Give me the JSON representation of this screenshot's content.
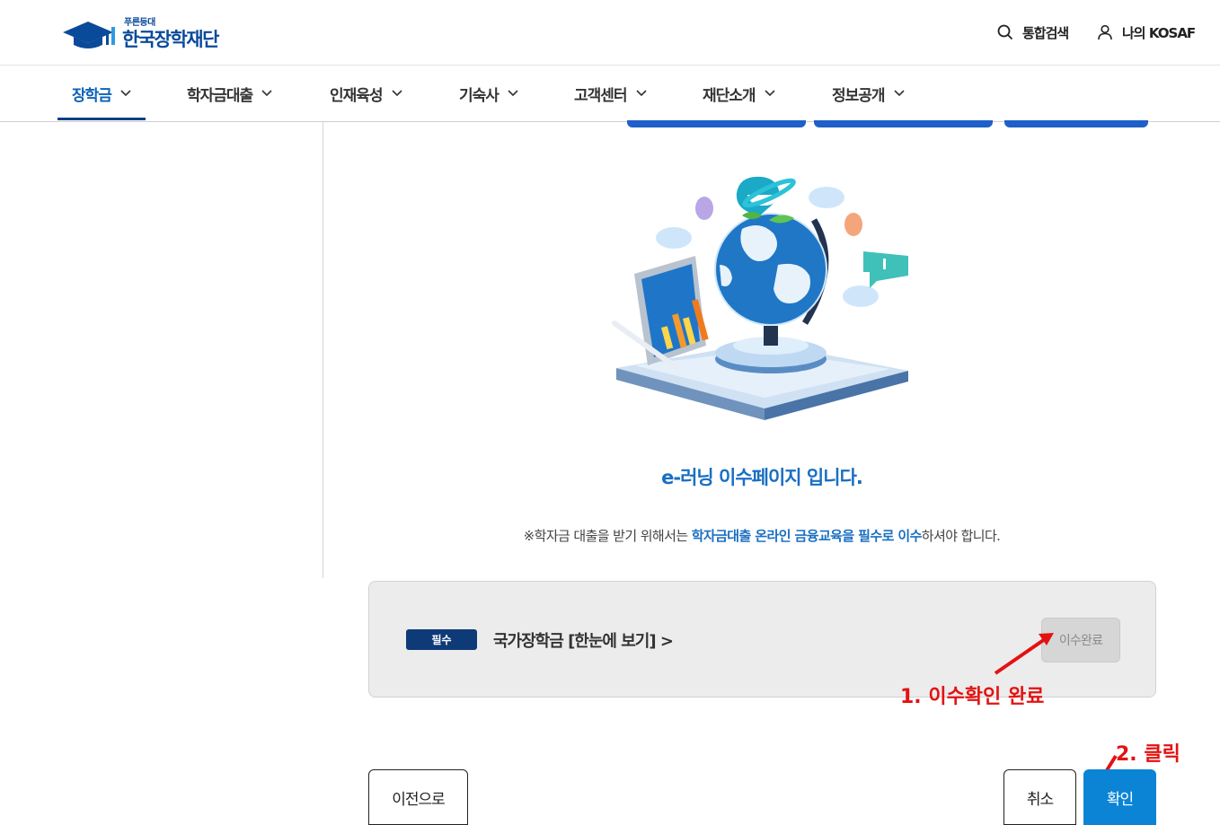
{
  "header": {
    "logo_small": "푸른등대",
    "logo_main": "한국장학재단",
    "search_label": "통합검색",
    "my_label": "나의 KOSAF"
  },
  "gnb": {
    "items": [
      {
        "label": "장학금",
        "active": true
      },
      {
        "label": "학자금대출"
      },
      {
        "label": "인재육성"
      },
      {
        "label": "기숙사"
      },
      {
        "label": "고객센터"
      },
      {
        "label": "재단소개"
      },
      {
        "label": "정보공개"
      }
    ]
  },
  "main": {
    "title": "e-러닝 이수페이지 입니다.",
    "notice_prefix": "※학자금 대출을 받기 위해서는 ",
    "notice_highlight": "학자금대출 온라인 금융교육을 필수로 이수",
    "notice_suffix": "하셔야 합니다."
  },
  "course": {
    "badge": "필수",
    "link_label": "국가장학금 [한눈에 보기] >",
    "status_label": "이수완료"
  },
  "annotations": {
    "step1": "1. 이수확인 완료",
    "step2": "2. 클릭"
  },
  "buttons": {
    "prev": "이전으로",
    "cancel": "취소",
    "ok": "확인"
  },
  "colors": {
    "brand": "#0a4a9a",
    "accent": "#1a6fc2",
    "ok_button": "#0b84d6",
    "badge": "#0f3a78",
    "annotation": "#e31212"
  }
}
